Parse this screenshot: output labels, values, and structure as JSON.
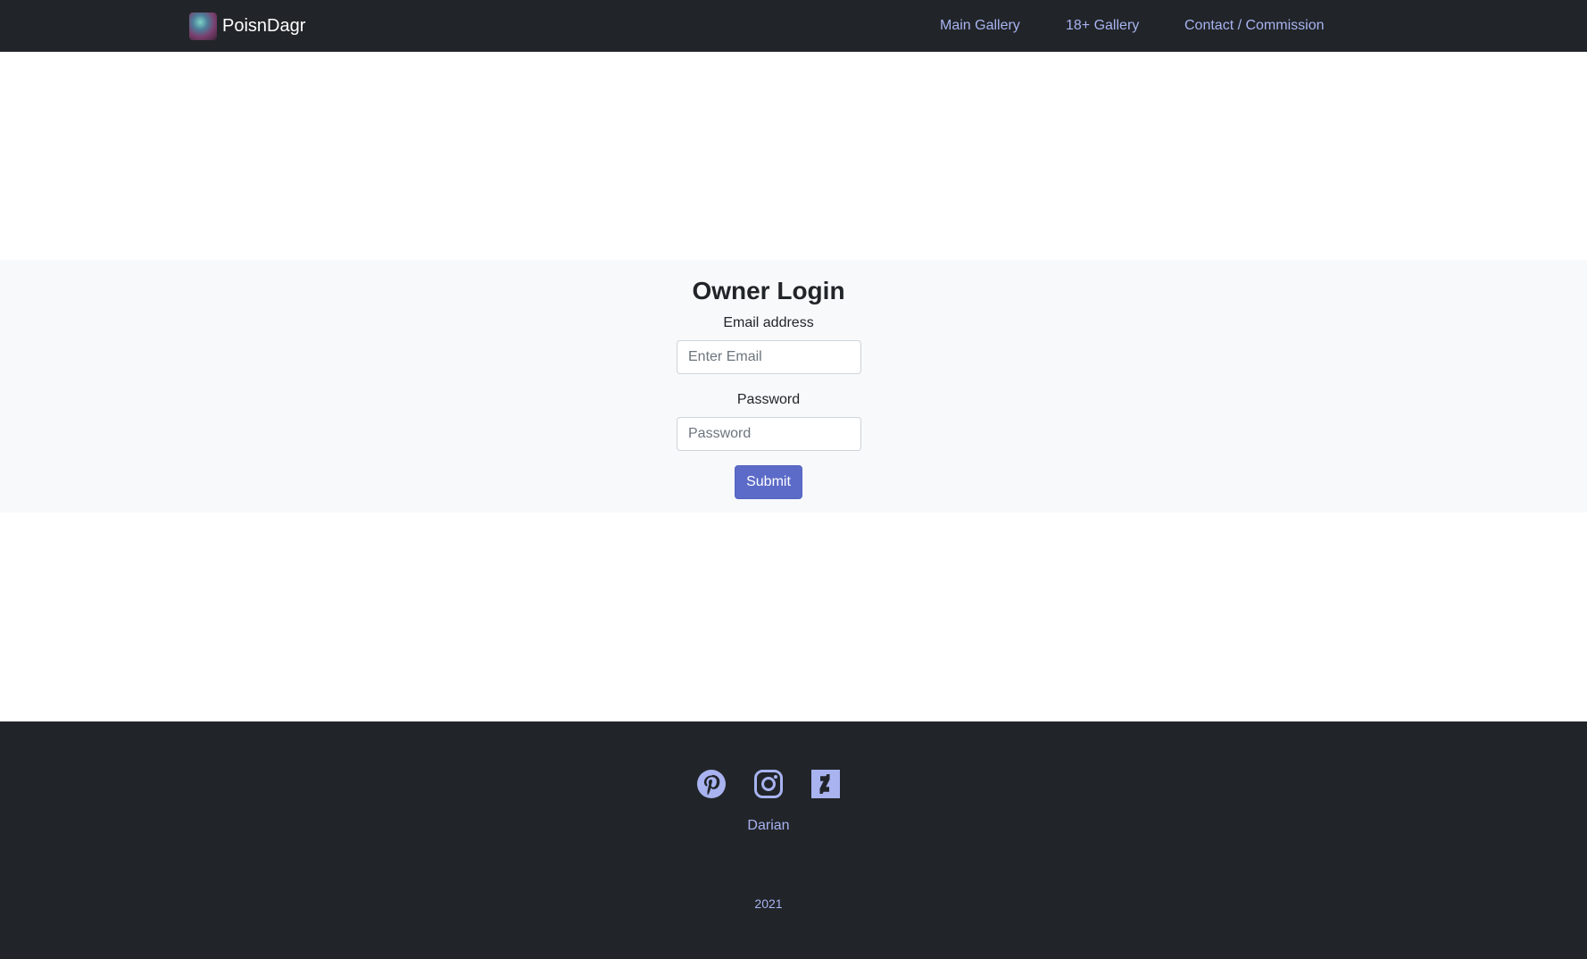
{
  "navbar": {
    "brand": "PoisnDagr",
    "links": [
      "Main Gallery",
      "18+ Gallery",
      "Contact / Commission"
    ]
  },
  "login": {
    "title": "Owner Login",
    "email_label": "Email address",
    "email_placeholder": "Enter Email",
    "password_label": "Password",
    "password_placeholder": "Password",
    "submit_label": "Submit"
  },
  "footer": {
    "social_icons": [
      "pinterest-icon",
      "instagram-icon",
      "deviantart-icon"
    ],
    "name": "Darian",
    "year": "2021"
  },
  "colors": {
    "navbar_bg": "#212529",
    "link": "#a8b3f0",
    "login_section_bg": "#f8f9fa",
    "submit_button": "#5c6bc8"
  }
}
